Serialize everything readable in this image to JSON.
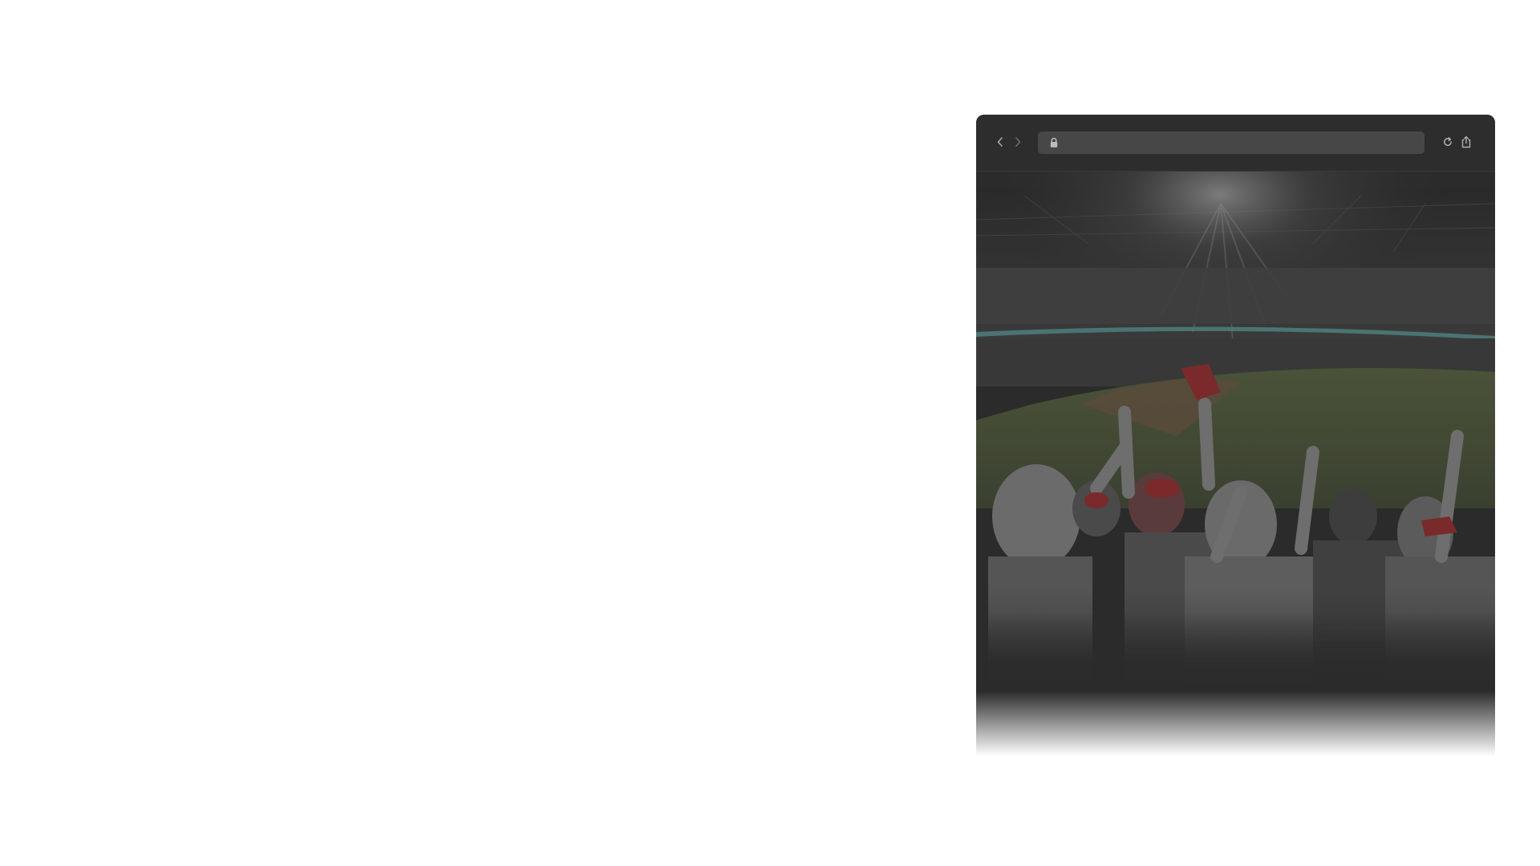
{
  "window": {
    "address": {
      "value": "",
      "placeholder": ""
    },
    "icons": {
      "back": "chevron-left-icon",
      "forward": "chevron-right-icon",
      "lock": "lock-icon",
      "reload": "reload-icon",
      "share": "share-icon"
    }
  },
  "content": {
    "image": "stadium-crowd-photo"
  },
  "colors": {
    "toolbar": "#2d2d2d",
    "address_bar": "#474747",
    "page_background": "#ffffff",
    "icon": "#9a9a9a"
  }
}
